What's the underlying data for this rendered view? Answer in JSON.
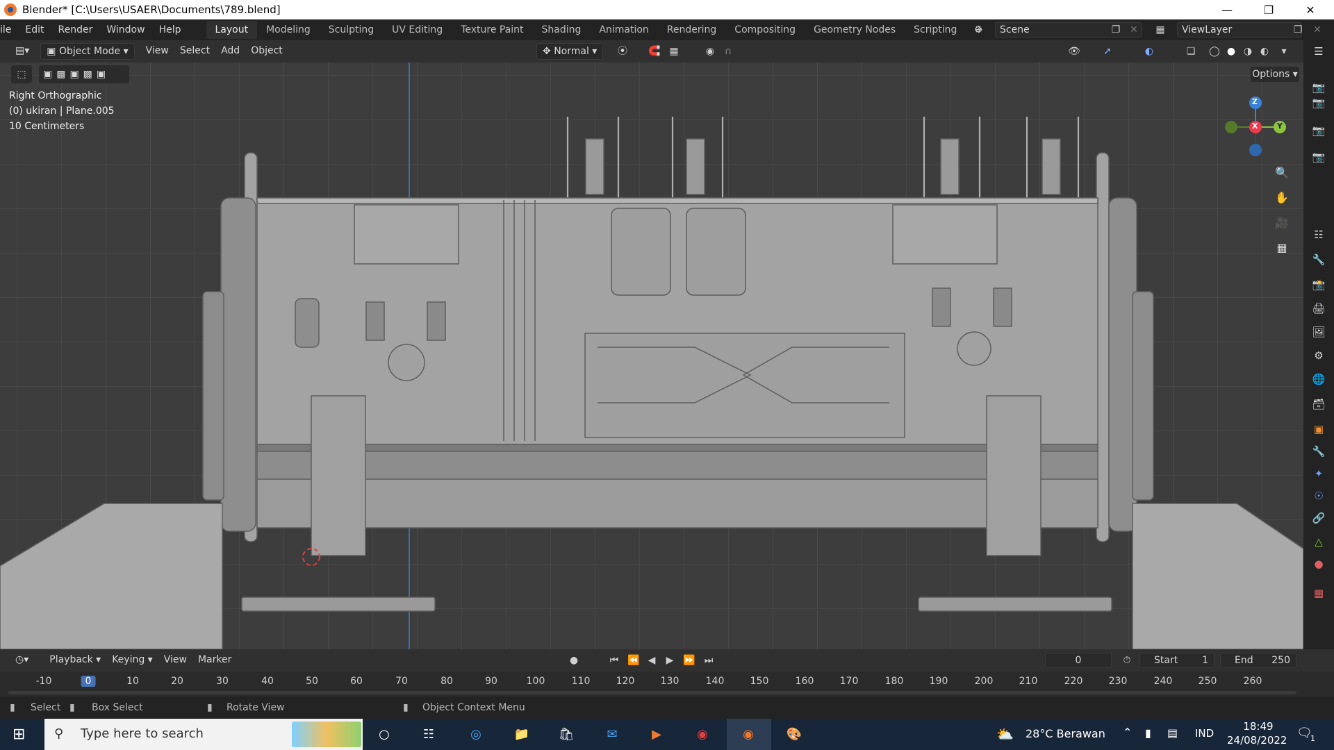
{
  "window": {
    "title": "Blender* [C:\\Users\\USAER\\Documents\\789.blend]",
    "minimize_icon": "minimize-icon",
    "restore_icon": "restore-icon",
    "close_icon": "close-icon"
  },
  "menu": {
    "items": [
      "ile",
      "Edit",
      "Render",
      "Window",
      "Help"
    ]
  },
  "workspaces": {
    "tabs": [
      "Layout",
      "Modeling",
      "Sculpting",
      "UV Editing",
      "Texture Paint",
      "Shading",
      "Animation",
      "Rendering",
      "Compositing",
      "Geometry Nodes",
      "Scripting"
    ],
    "active": "Layout",
    "add_label": "+"
  },
  "scene": {
    "label": "Scene",
    "view_layer": "ViewLayer"
  },
  "viewport_header": {
    "mode": "Object Mode",
    "view": "View",
    "select": "Select",
    "add": "Add",
    "object": "Object",
    "orientation": "Normal",
    "options": "Options"
  },
  "viewport": {
    "view_name": "Right Orthographic",
    "object_info": "(0) ukiran | Plane.005",
    "scale": "10 Centimeters",
    "gizmo": {
      "z": "Z",
      "x": "X",
      "y": "Y"
    },
    "colors": {
      "background": "#3d3d3d",
      "model": "#9a9a9a",
      "x_axis": "#ee3a4f",
      "y_axis": "#8bc53f",
      "z_axis": "#3b83d9"
    }
  },
  "timeline": {
    "playback": "Playback",
    "keying": "Keying",
    "view": "View",
    "marker": "Marker",
    "current_frame": "0",
    "start_label": "Start",
    "start_value": "1",
    "end_label": "End",
    "end_value": "250",
    "ruler": [
      "-10",
      "0",
      "10",
      "20",
      "30",
      "40",
      "50",
      "60",
      "70",
      "80",
      "90",
      "100",
      "110",
      "120",
      "130",
      "140",
      "150",
      "160",
      "170",
      "180",
      "190",
      "200",
      "210",
      "220",
      "230",
      "240",
      "250",
      "260"
    ]
  },
  "status": {
    "select": "Select",
    "box_select": "Box Select",
    "rotate_view": "Rotate View",
    "context_menu": "Object Context Menu"
  },
  "taskbar": {
    "search_placeholder": "Type here to search",
    "weather": "28°C  Berawan",
    "lang": "IND",
    "time": "18:49",
    "date": "24/08/2022",
    "notification_count": "1"
  }
}
